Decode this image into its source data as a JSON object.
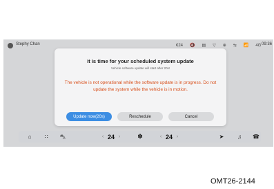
{
  "status_bar": {
    "user_name": "Stephy Chan",
    "indicators": [
      "€24",
      "🔇",
      "▤",
      "▽",
      "⊕",
      "⇆",
      "📶",
      "4G"
    ],
    "time": "09:36"
  },
  "modal": {
    "title": "It is time for your scheduled system update",
    "subtitle": "Vehicle software update will start after 20s!",
    "warning": "The vehicle is not operational while the software update is in progress. Do not update the system while the vehicle is in motion.",
    "update_label": "Update now(20s)",
    "reschedule_label": "Reschedule",
    "cancel_label": "Cancel"
  },
  "dock": {
    "left_temp": "24",
    "right_temp": "24",
    "temp_down": "‹",
    "temp_up": "›",
    "icons": {
      "home": "⌂",
      "apps": "∷",
      "car": "⛍",
      "fan": "✽",
      "nav": "➤",
      "music": "♫",
      "phone": "☎"
    }
  },
  "colors": {
    "accent": "#3d8ee3",
    "warning": "#d9501c"
  },
  "caption": "OMT26-2144"
}
